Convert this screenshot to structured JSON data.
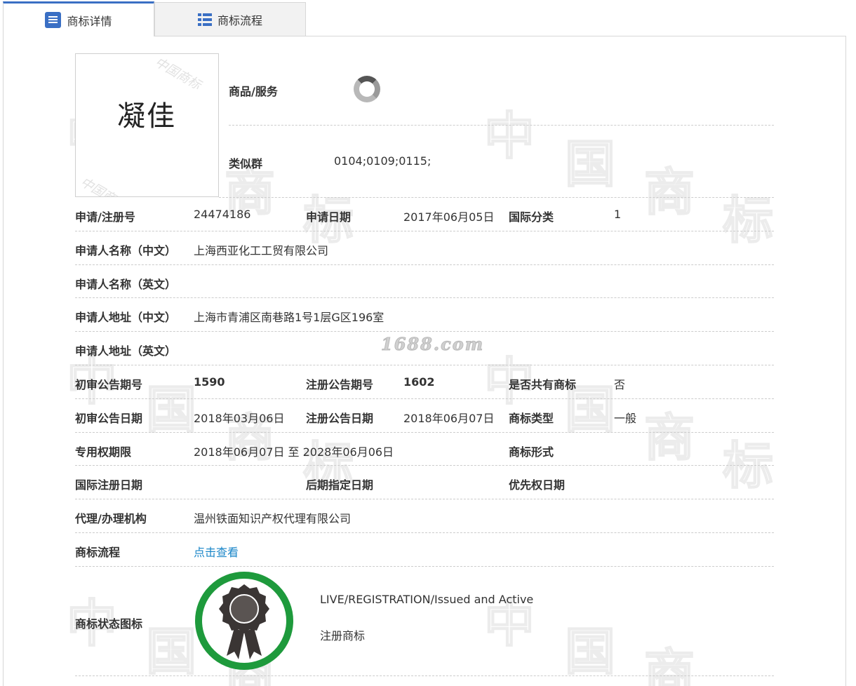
{
  "tabs": [
    {
      "label": "商标详情",
      "icon": "list-doc-icon"
    },
    {
      "label": "商标流程",
      "icon": "list-icon"
    }
  ],
  "logo": {
    "text": "凝佳",
    "watermark": "中国商标"
  },
  "site_watermark": "1688.com",
  "top_rows": {
    "goods_label": "商品/服务",
    "similar_label": "类似群",
    "similar_value": "0104;0109;0115;"
  },
  "fields": {
    "reg_no_label": "申请/注册号",
    "reg_no_value": "24474186",
    "app_date_label": "申请日期",
    "app_date_value": "2017年06月05日",
    "intl_class_label": "国际分类",
    "intl_class_value": "1",
    "applicant_cn_label": "申请人名称（中文）",
    "applicant_cn_value": "上海西亚化工工贸有限公司",
    "applicant_en_label": "申请人名称（英文）",
    "addr_cn_label": "申请人地址（中文）",
    "addr_cn_value": "上海市青浦区南巷路1号1层G区196室",
    "addr_en_label": "申请人地址（英文）",
    "prelim_no_label": "初审公告期号",
    "prelim_no_value": "1590",
    "reg_pub_no_label": "注册公告期号",
    "reg_pub_no_value": "1602",
    "shared_label": "是否共有商标",
    "shared_value": "否",
    "prelim_date_label": "初审公告日期",
    "prelim_date_value": "2018年03月06日",
    "reg_pub_date_label": "注册公告日期",
    "reg_pub_date_value": "2018年06月07日",
    "tm_type_label": "商标类型",
    "tm_type_value": "一般",
    "exclusive_label": "专用权期限",
    "exclusive_value": "2018年06月07日 至 2028年06月06日",
    "tm_form_label": "商标形式",
    "intl_reg_date_label": "国际注册日期",
    "later_date_label": "后期指定日期",
    "priority_date_label": "优先权日期",
    "agent_label": "代理/办理机构",
    "agent_value": "温州铁面知识产权代理有限公司",
    "process_label": "商标流程",
    "process_link": "点击查看",
    "status_label": "商标状态图标",
    "status_en": "LIVE/REGISTRATION/Issued and Active",
    "status_cn": "注册商标"
  },
  "colors": {
    "accent": "#3a6fc4",
    "link": "#1a86c8",
    "status_ring": "#1e9a3c"
  }
}
